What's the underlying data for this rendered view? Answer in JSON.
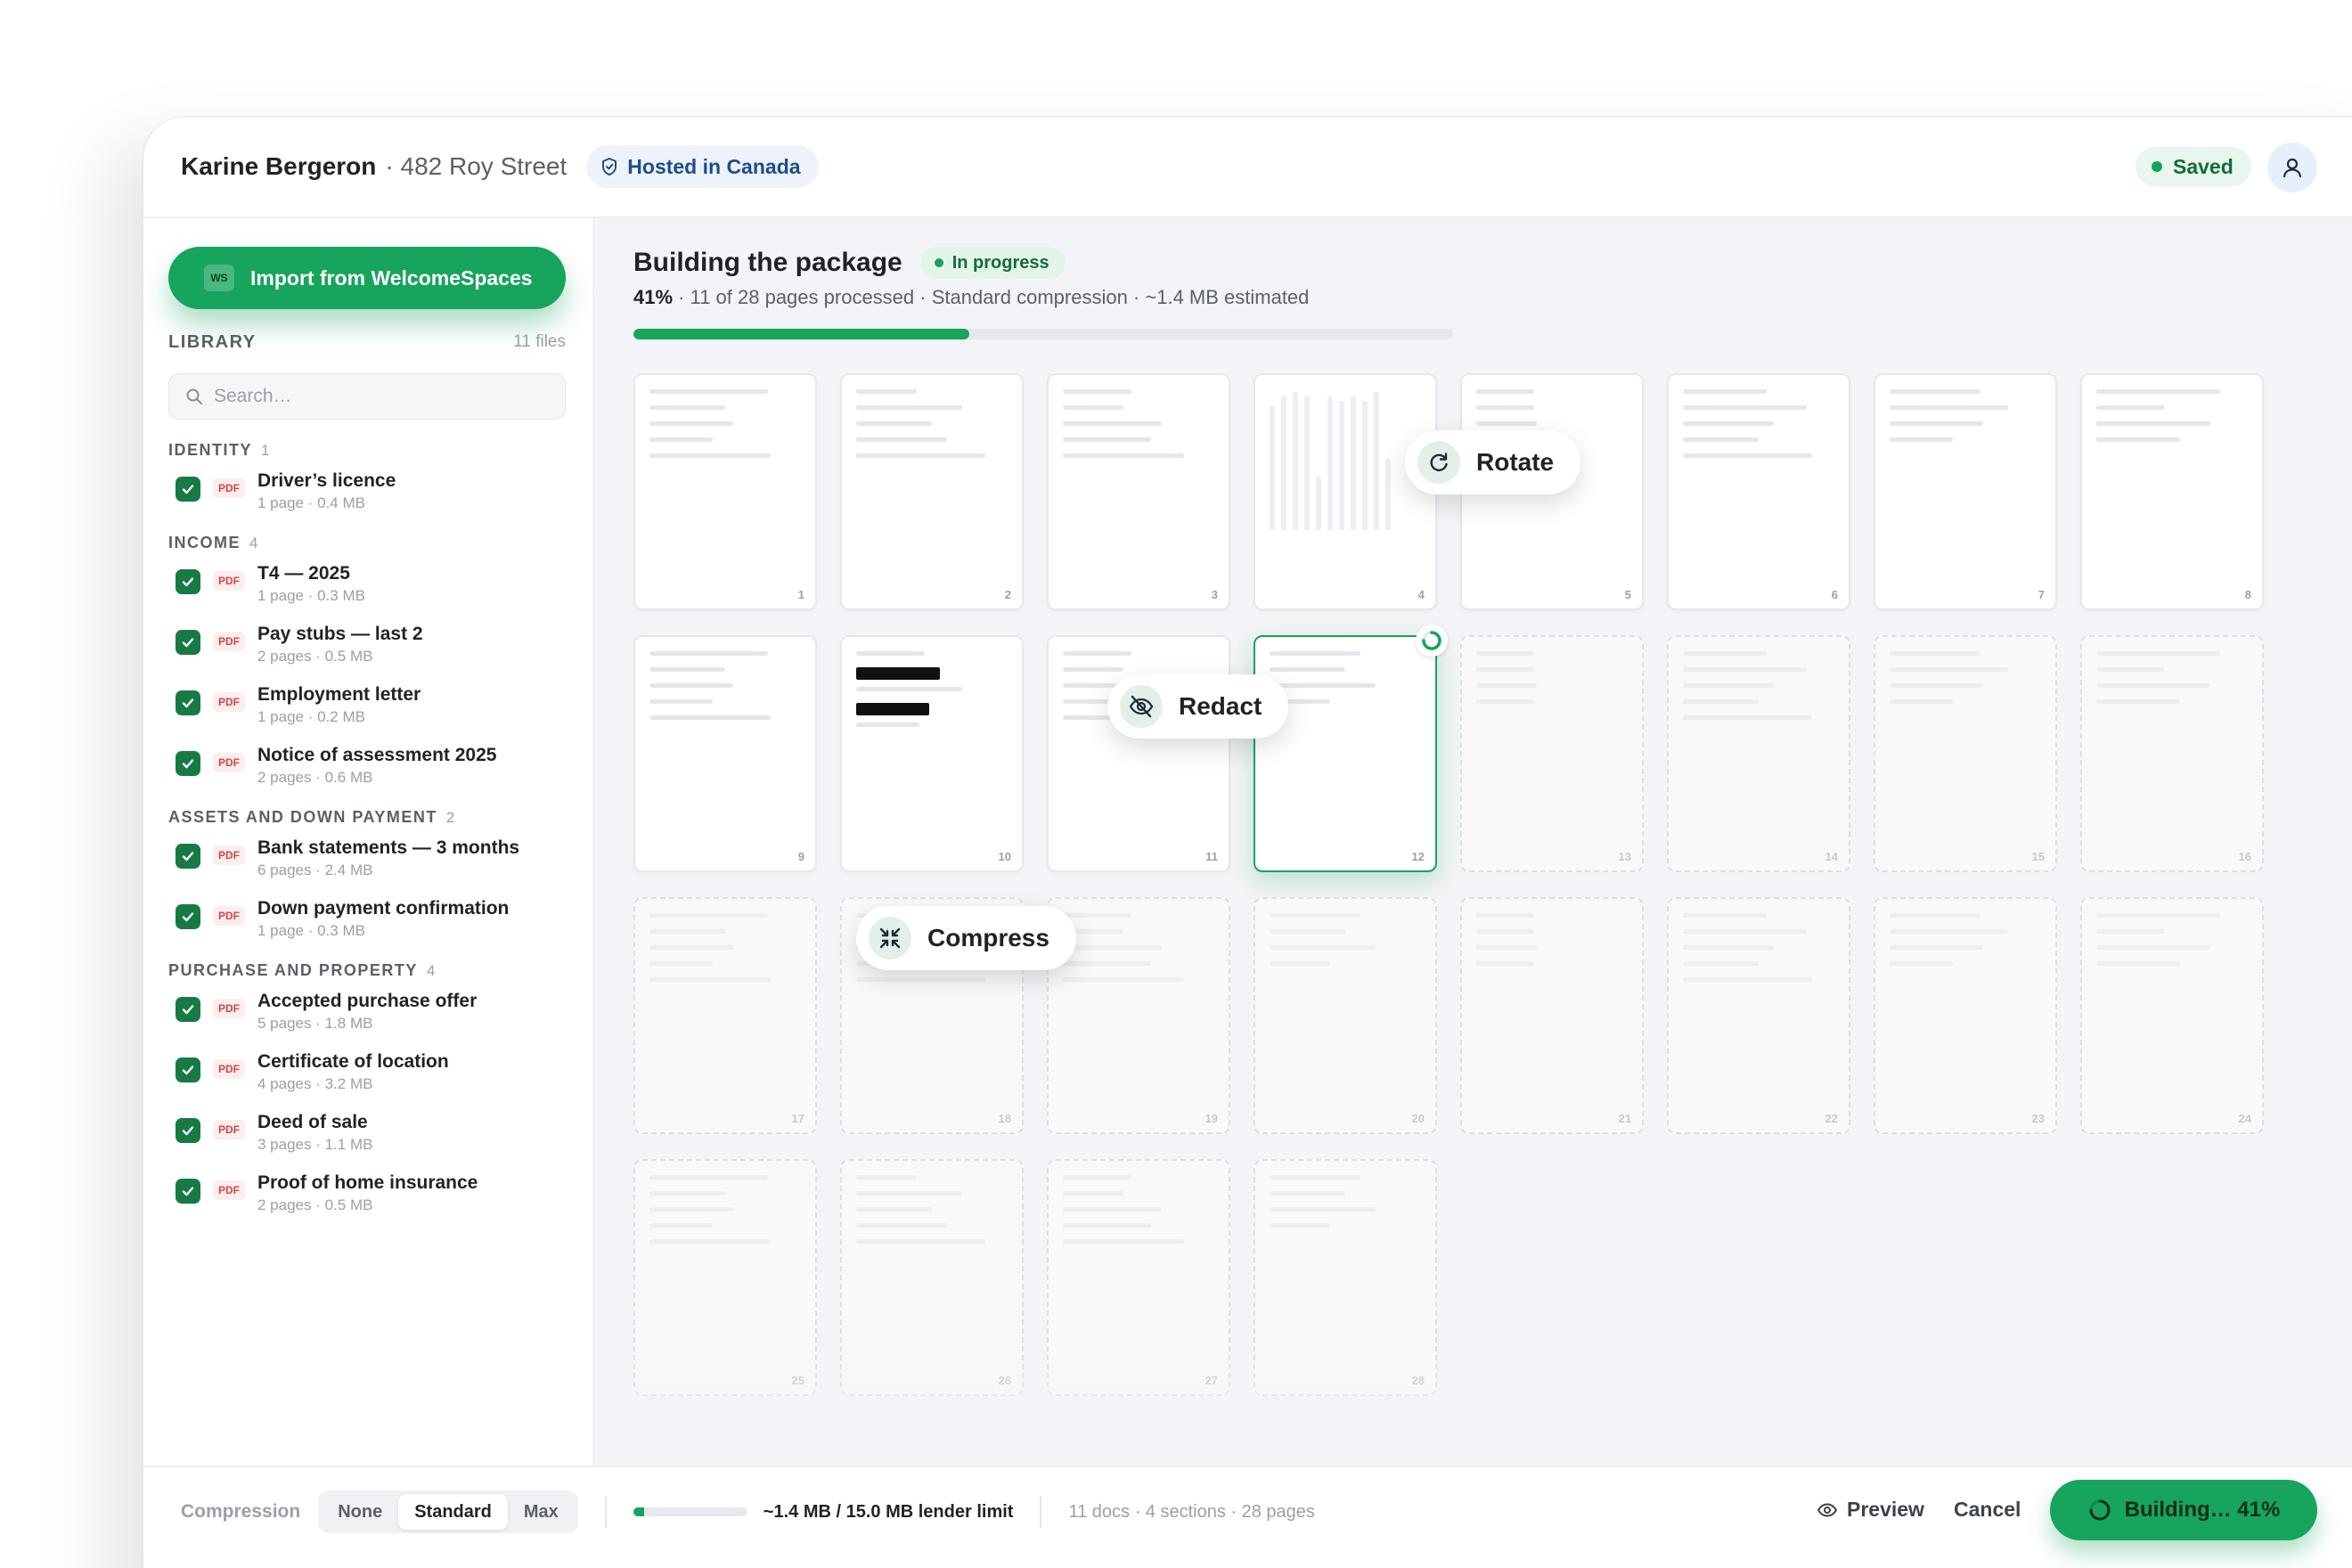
{
  "header": {
    "client_name": "Karine Bergeron",
    "client_address": "· 482 Roy Street",
    "hosting_badge": "Hosted in Canada",
    "save_status": "Saved"
  },
  "sidebar": {
    "import_label": "Import from WelcomeSpaces",
    "import_badge": "WS",
    "library_title": "LIBRARY",
    "library_count": "11 files",
    "search_placeholder": "Search…",
    "sections": [
      {
        "title": "IDENTITY",
        "count": "1",
        "docs": [
          {
            "name": "Driver’s licence",
            "meta": "1 page · 0.4 MB",
            "type": "PDF"
          }
        ]
      },
      {
        "title": "INCOME",
        "count": "4",
        "docs": [
          {
            "name": "T4 — 2025",
            "meta": "1 page · 0.3 MB",
            "type": "PDF"
          },
          {
            "name": "Pay stubs — last 2",
            "meta": "2 pages · 0.5 MB",
            "type": "PDF"
          },
          {
            "name": "Employment letter",
            "meta": "1 page · 0.2 MB",
            "type": "PDF"
          },
          {
            "name": "Notice of assessment 2025",
            "meta": "2 pages · 0.6 MB",
            "type": "PDF"
          }
        ]
      },
      {
        "title": "ASSETS AND DOWN PAYMENT",
        "count": "2",
        "docs": [
          {
            "name": "Bank statements — 3 months",
            "meta": "6 pages · 2.4 MB",
            "type": "PDF"
          },
          {
            "name": "Down payment confirmation",
            "meta": "1 page · 0.3 MB",
            "type": "PDF"
          }
        ]
      },
      {
        "title": "PURCHASE AND PROPERTY",
        "count": "4",
        "docs": [
          {
            "name": "Accepted purchase offer",
            "meta": "5 pages · 1.8 MB",
            "type": "PDF"
          },
          {
            "name": "Certificate of location",
            "meta": "4 pages · 3.2 MB",
            "type": "PDF"
          },
          {
            "name": "Deed of sale",
            "meta": "3 pages · 1.1 MB",
            "type": "PDF"
          },
          {
            "name": "Proof of home insurance",
            "meta": "2 pages · 0.5 MB",
            "type": "PDF"
          }
        ]
      }
    ]
  },
  "build": {
    "title": "Building the package",
    "status_badge": "In progress",
    "percent_label": "41%",
    "detail": " · 11 of 28 pages processed · Standard compression · ~1.4 MB estimated",
    "progress": 0.41,
    "total_pages": 28,
    "processed_pages": 11,
    "active_page": 12
  },
  "pages": [
    "1",
    "2",
    "3",
    "4",
    "5",
    "6",
    "7",
    "8",
    "9",
    "10",
    "11",
    "12",
    "13",
    "14",
    "15",
    "16",
    "17",
    "18",
    "19",
    "20",
    "21",
    "22",
    "23",
    "24",
    "25",
    "26",
    "27",
    "28"
  ],
  "operations": {
    "rotate": "Rotate",
    "redact": "Redact",
    "compress": "Compress"
  },
  "footer": {
    "compression_label": "Compression",
    "compression_options": [
      "None",
      "Standard",
      "Max"
    ],
    "compression_selected": "Standard",
    "size_fraction": 0.093,
    "size_label": "~1.4 MB / 15.0 MB lender limit",
    "summary": "11 docs · 4 sections · 28 pages",
    "preview_label": "Preview",
    "cancel_label": "Cancel",
    "build_label": "Building… 41%"
  },
  "colors": {
    "accent": "#17a45c",
    "accent_dark": "#177a45",
    "hosted_text": "#1d4e89",
    "pdf_red": "#d64545"
  }
}
